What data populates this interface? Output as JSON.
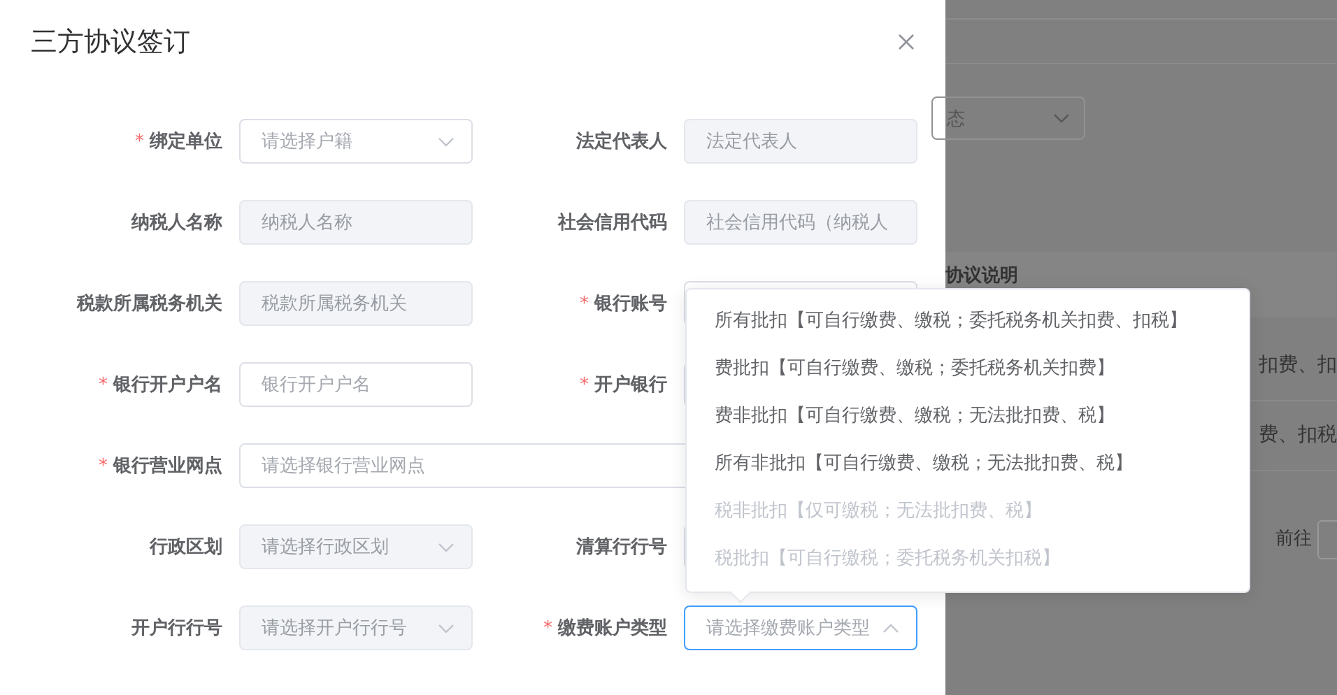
{
  "background": {
    "status_select": {
      "value": "态"
    },
    "table_header": "协议说明",
    "rows": [
      "扣费、扣",
      "费、扣税"
    ],
    "pager_label": "前往"
  },
  "dialog": {
    "title": "三方协议签订",
    "rows": [
      {
        "left": {
          "label": "绑定单位",
          "required_mark": "*",
          "kind": "select",
          "placeholder": "请选择户籍",
          "disabled": false
        },
        "right": {
          "label": "法定代表人",
          "kind": "input",
          "placeholder": "法定代表人",
          "disabled": true
        }
      },
      {
        "left": {
          "label": "纳税人名称",
          "kind": "input",
          "placeholder": "纳税人名称",
          "disabled": true
        },
        "right": {
          "label": "社会信用代码",
          "kind": "input",
          "placeholder": "社会信用代码（纳税人",
          "disabled": true
        }
      },
      {
        "left": {
          "label": "税款所属税务机关",
          "kind": "input",
          "placeholder": "税款所属税务机关",
          "disabled": true
        },
        "right": {
          "label": "银行账号",
          "required_mark": "*",
          "kind": "input"
        }
      },
      {
        "left": {
          "label": "银行开户户名",
          "required_mark": "*",
          "kind": "input",
          "placeholder": "银行开户户名",
          "disabled": false
        },
        "right": {
          "label": "开户银行",
          "required_mark": "*",
          "kind": "input"
        }
      },
      {
        "left": {
          "label": "银行营业网点",
          "required_mark": "*",
          "kind": "wide",
          "placeholder": "请选择银行营业网点",
          "disabled": false
        }
      },
      {
        "left": {
          "label": "行政区划",
          "kind": "select",
          "placeholder": "请选择行政区划",
          "disabled": true
        },
        "right": {
          "label": "清算行行号",
          "kind": "input"
        }
      },
      {
        "left": {
          "label": "开户行行号",
          "kind": "select",
          "placeholder": "请选择开户行行号",
          "disabled": true
        },
        "right": {
          "label": "缴费账户类型",
          "required_mark": "*",
          "kind": "select",
          "placeholder": "请选择缴费账户类型",
          "disabled": false,
          "open": true
        }
      }
    ],
    "dropdown": [
      {
        "label": "所有批扣【可自行缴费、缴税；委托税务机关扣费、扣税】",
        "disabled": false
      },
      {
        "label": "费批扣【可自行缴费、缴税；委托税务机关扣费】",
        "disabled": false
      },
      {
        "label": "费非批扣【可自行缴费、缴税；无法批扣费、税】",
        "disabled": false
      },
      {
        "label": "所有非批扣【可自行缴费、缴税；无法批扣费、税】",
        "disabled": false
      },
      {
        "label": "税非批扣【仅可缴税；无法批扣费、税】",
        "disabled": true
      },
      {
        "label": "税批扣【可自行缴税；委托税务机关扣税】",
        "disabled": true
      }
    ]
  }
}
